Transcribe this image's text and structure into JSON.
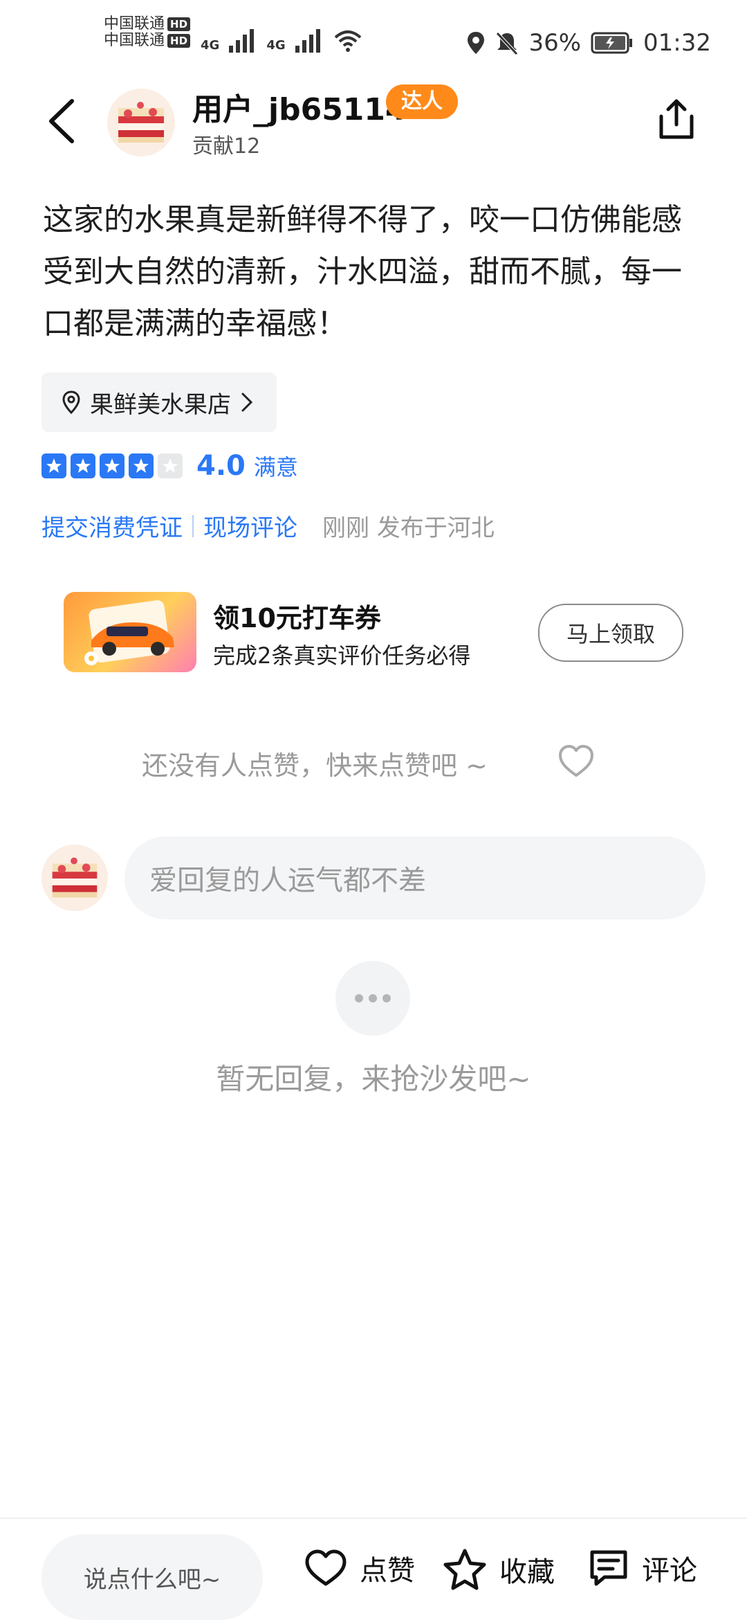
{
  "status_bar": {
    "carrier1": "中国联通",
    "carrier2": "中国联通",
    "hd": "HD",
    "network": "4G",
    "battery": "36%",
    "time": "01:32"
  },
  "header": {
    "username": "用户_jb65114",
    "badge": "达人",
    "contribution": "贡献12"
  },
  "review": {
    "text": "这家的水果真是新鲜得不得了，咬一口仿佛能感受到大自然的清新，汁水四溢，甜而不腻，每一口都是满满的幸福感！",
    "store": "果鲜美水果店",
    "rating": 4.0,
    "rating_display": "4.0",
    "rating_label": "满意",
    "stars_filled": 4,
    "stars_total": 5,
    "link1": "提交消费凭证",
    "link2": "现场评论",
    "meta": "刚刚 发布于河北"
  },
  "promo": {
    "title": "领10元打车券",
    "subtitle": "完成2条真实评价任务必得",
    "button": "马上领取"
  },
  "likes": {
    "hint": "还没有人点赞，快来点赞吧 ~"
  },
  "reply": {
    "placeholder": "爱回复的人运气都不差",
    "empty": "暂无回复，来抢沙发吧~"
  },
  "bottom_bar": {
    "comment_placeholder": "说点什么吧~",
    "like": "点赞",
    "favorite": "收藏",
    "comment": "评论"
  },
  "colors": {
    "accent": "#2a78f5",
    "badge": "#ff8a1a"
  }
}
